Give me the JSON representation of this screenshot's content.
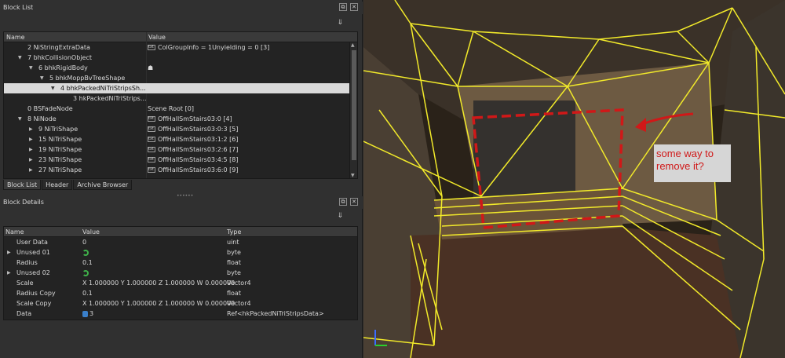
{
  "block_list": {
    "title": "Block List",
    "columns": {
      "name": "Name",
      "value": "Value"
    },
    "rows": [
      {
        "name": "2 NiStringExtraData",
        "value": "ColGroupInfo = 1Unyielding = 0 [3]"
      },
      {
        "name": "7 bhkCollisionObject",
        "value": ""
      },
      {
        "name": "6 bhkRigidBody",
        "value": ""
      },
      {
        "name": "5 bhkMoppBvTreeShape",
        "value": ""
      },
      {
        "name": "4 bhkPackedNiTriStripsSh...",
        "value": ""
      },
      {
        "name": "3 hkPackedNiTriStrips...",
        "value": ""
      },
      {
        "name": "0 BSFadeNode",
        "value": "Scene Root [0]"
      },
      {
        "name": "8 NiNode",
        "value": "OffHallSmStairs03:0 [4]"
      },
      {
        "name": "9 NiTriShape",
        "value": "OffHallSmStairs03:0:3 [5]"
      },
      {
        "name": "15 NiTriShape",
        "value": "OffHallSmStairs03:1:2 [6]"
      },
      {
        "name": "19 NiTriShape",
        "value": "OffHallSmStairs03:2:6 [7]"
      },
      {
        "name": "23 NiTriShape",
        "value": "OffHallSmStairs03:4:5 [8]"
      },
      {
        "name": "27 NiTriShape",
        "value": "OffHallSmStairs03:6:0 [9]"
      }
    ],
    "tabs": [
      "Block List",
      "Header",
      "Archive Browser"
    ]
  },
  "block_details": {
    "title": "Block Details",
    "columns": {
      "name": "Name",
      "value": "Value",
      "type": "Type"
    },
    "rows": [
      {
        "name": "User Data",
        "value": "0",
        "type": "uint"
      },
      {
        "name": "Unused 01",
        "value": "",
        "type": "byte"
      },
      {
        "name": "Radius",
        "value": "0.1",
        "type": "float"
      },
      {
        "name": "Unused 02",
        "value": "",
        "type": "byte"
      },
      {
        "name": "Scale",
        "value": "X 1.000000 Y 1.000000 Z 1.000000 W 0.000000",
        "type": "Vector4"
      },
      {
        "name": "Radius Copy",
        "value": "0.1",
        "type": "float"
      },
      {
        "name": "Scale Copy",
        "value": "X 1.000000 Y 1.000000 Z 1.000000 W 0.000000",
        "type": "Vector4"
      },
      {
        "name": "Data",
        "value": "3 [hkPackedNiTriStripsData]",
        "type": "Ref<hkPackedNiTriStripsData>"
      }
    ]
  },
  "viewport": {
    "annotation": "some way to remove it?",
    "wire_color": "#f2ea2a",
    "annotation_color": "#d01818"
  }
}
